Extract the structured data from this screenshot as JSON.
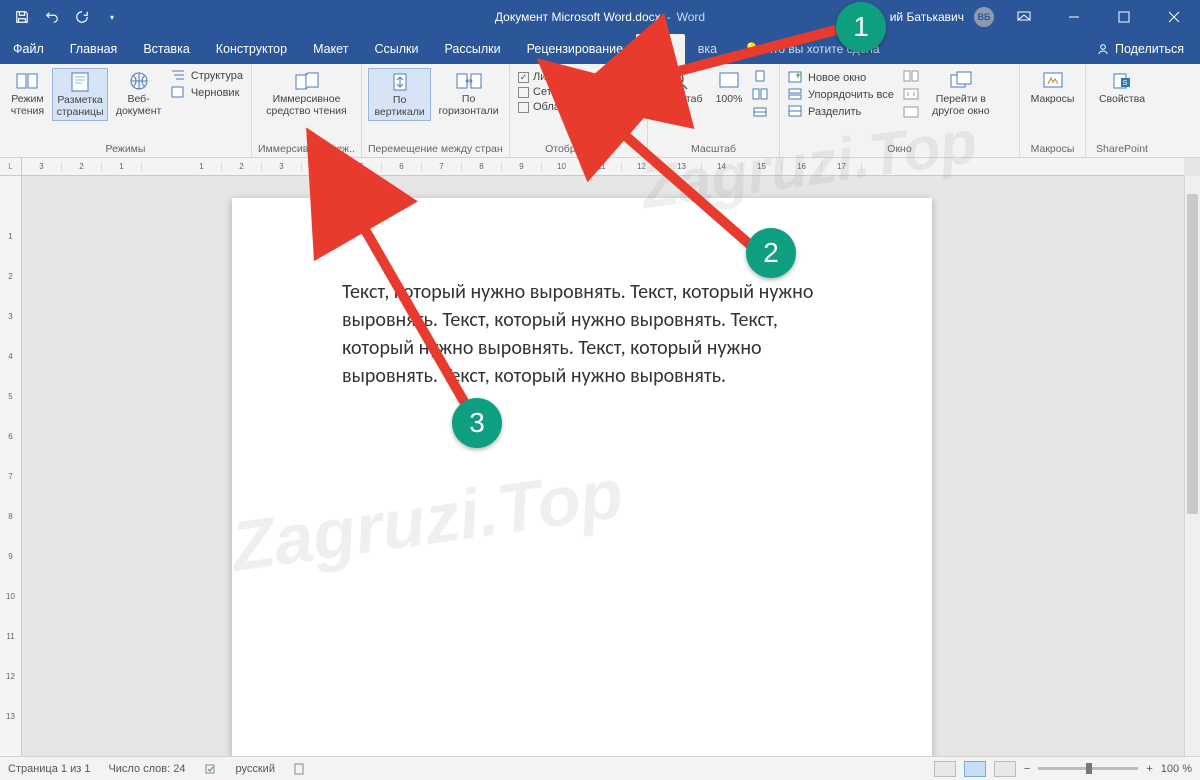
{
  "titlebar": {
    "document_name": "Документ Microsoft Word.docx",
    "separator": "-",
    "app_name": "Word",
    "user_name_visible": "ий Батькавич",
    "user_initials": "ВБ"
  },
  "tabs": {
    "file": "Файл",
    "home": "Главная",
    "insert": "Вставка",
    "design": "Конструктор",
    "layout": "Макет",
    "references": "Ссылки",
    "mailings": "Рассылки",
    "review": "Рецензирование",
    "view": "Вид",
    "help": "вка",
    "tell_me": "Что вы хотите сдела",
    "share": "Поделиться"
  },
  "ribbon": {
    "modes": {
      "read": "Режим чтения",
      "print_layout": "Разметка страницы",
      "web": "Веб-документ",
      "outline": "Структура",
      "draft": "Черновик",
      "group_label": "Режимы"
    },
    "immersive": {
      "button": "Иммерсивное средство чтения",
      "group_label": "Иммерсивный реж..."
    },
    "page_movement": {
      "vertical": "По вертикали",
      "horizontal": "По горизонтали",
      "group_label": "Перемещение между стран..."
    },
    "show": {
      "ruler": "Линейка",
      "grid": "Сетка",
      "nav_pane": "Область навигации",
      "group_label": "Отображение"
    },
    "zoom": {
      "zoom": "Масштаб",
      "hundred": "100%",
      "group_label": "Масштаб"
    },
    "window": {
      "new_window": "Новое окно",
      "arrange_all": "Упорядочить все",
      "split": "Разделить",
      "switch": "Перейти в другое окно",
      "group_label": "Окно"
    },
    "macros": {
      "button": "Макросы",
      "group_label": "Макросы"
    },
    "sharepoint": {
      "button": "Свойства",
      "group_label": "SharePoint"
    }
  },
  "document": {
    "text": "Текст, который нужно выровнять. Текст, который нужно выровнять. Текст, который нужно выровнять. Текст, который нужно выровнять. Текст, который нужно выровнять. Текст, который нужно выровнять."
  },
  "ruler_h": [
    "3",
    "2",
    "1",
    "",
    "1",
    "2",
    "3",
    "4",
    "5",
    "6",
    "7",
    "8",
    "9",
    "10",
    "11",
    "12",
    "13",
    "14",
    "15",
    "16",
    "17"
  ],
  "ruler_v": [
    "",
    "1",
    "2",
    "3",
    "4",
    "5",
    "6",
    "7",
    "8",
    "9",
    "10",
    "11",
    "12",
    "13"
  ],
  "status": {
    "page": "Страница 1 из 1",
    "words": "Число слов: 24",
    "language": "русский",
    "zoom": "100 %"
  },
  "annotations": {
    "n1": "1",
    "n2": "2",
    "n3": "3"
  },
  "watermark": "Zagruzi.Top"
}
